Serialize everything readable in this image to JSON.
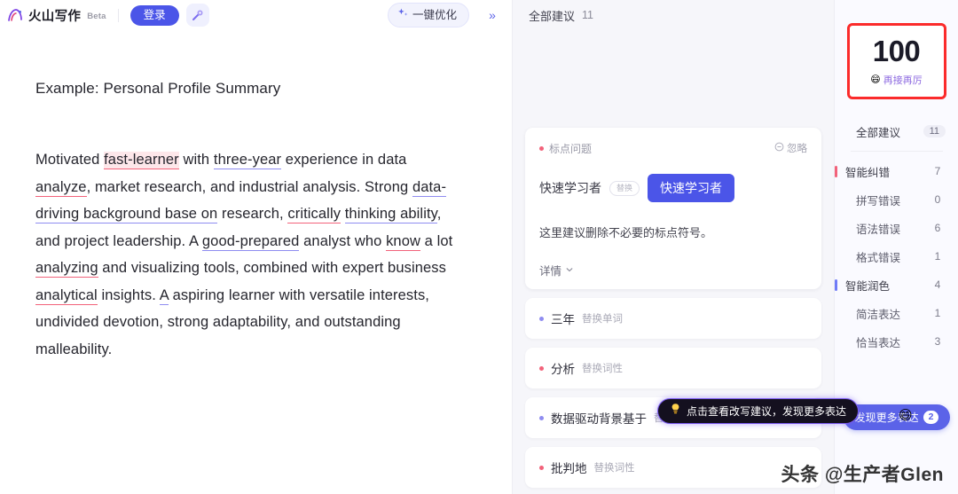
{
  "header": {
    "brand_name": "火山写作",
    "beta_tag": "Beta",
    "login_label": "登录",
    "magic_icon": "magic-wand-icon",
    "optimize_label": "一键优化",
    "optimize_icon": "sparkle-icon",
    "collapse_icon": "double-chevron-right-icon"
  },
  "document": {
    "title": "Example: Personal Profile Summary",
    "paragraph_segments": [
      {
        "text": "Motivated ",
        "style": "plain"
      },
      {
        "text": "fast-learner",
        "style": "highlight-red"
      },
      {
        "text": " with ",
        "style": "plain"
      },
      {
        "text": "three-year",
        "style": "underline-purple"
      },
      {
        "text": " experience in data ",
        "style": "plain"
      },
      {
        "text": "analyze",
        "style": "underline-red"
      },
      {
        "text": ", market research, and industrial analysis. Strong ",
        "style": "plain"
      },
      {
        "text": "data-driving background base on",
        "style": "underline-purple"
      },
      {
        "text": " research, ",
        "style": "plain"
      },
      {
        "text": "critically",
        "style": "underline-red"
      },
      {
        "text": " ",
        "style": "plain"
      },
      {
        "text": "thinking ability",
        "style": "underline-purple"
      },
      {
        "text": ", and project leadership. A ",
        "style": "plain"
      },
      {
        "text": "good-prepared",
        "style": "underline-purple"
      },
      {
        "text": " analyst who ",
        "style": "plain"
      },
      {
        "text": "know",
        "style": "underline-red"
      },
      {
        "text": " a lot ",
        "style": "plain"
      },
      {
        "text": "analyzing",
        "style": "underline-red"
      },
      {
        "text": " and visualizing tools, combined with expert business ",
        "style": "plain"
      },
      {
        "text": "analytical",
        "style": "underline-red"
      },
      {
        "text": " insights. ",
        "style": "plain"
      },
      {
        "text": "A",
        "style": "underline-purple"
      },
      {
        "text": " aspiring learner with versatile interests, undivided devotion, strong adaptability, and outstanding malleability.",
        "style": "plain"
      }
    ]
  },
  "suggestions_panel": {
    "title": "全部建议",
    "count": "11",
    "card": {
      "tag": "标点问题",
      "tag_dot_color": "#f2627a",
      "ignore_label": "忽略",
      "ignore_icon": "circle-minus-icon",
      "original": "快速学习者",
      "arrow": "替换",
      "replacement": "快速学习者",
      "description": "这里建议删除不必要的标点符号。",
      "more_label": "详情",
      "more_icon": "chevron-down-icon"
    },
    "rows": [
      {
        "word": "三年",
        "kind": "替换单词",
        "dot": "purple"
      },
      {
        "word": "分析",
        "kind": "替换词性",
        "dot": "red"
      },
      {
        "word": "数据驱动背景基于",
        "kind": "替换",
        "dot": "purple"
      },
      {
        "word": "批判地",
        "kind": "替换词性",
        "dot": "red"
      }
    ]
  },
  "score": {
    "value": "100",
    "subtitle": "再接再厉",
    "emoji": "😄"
  },
  "categories": [
    {
      "name": "全部建议",
      "count": "11",
      "bar": "none",
      "level": "all",
      "pill": true
    },
    {
      "name": "智能纠错",
      "count": "7",
      "bar": "red",
      "level": "main",
      "pill": false
    },
    {
      "name": "拼写错误",
      "count": "0",
      "bar": "none",
      "level": "sub",
      "pill": false
    },
    {
      "name": "语法错误",
      "count": "6",
      "bar": "none",
      "level": "sub",
      "pill": false
    },
    {
      "name": "格式错误",
      "count": "1",
      "bar": "none",
      "level": "sub",
      "pill": false
    },
    {
      "name": "智能润色",
      "count": "4",
      "bar": "purple",
      "level": "main",
      "pill": false
    },
    {
      "name": "简洁表达",
      "count": "1",
      "bar": "none",
      "level": "sub",
      "pill": false
    },
    {
      "name": "恰当表达",
      "count": "3",
      "bar": "none",
      "level": "sub",
      "pill": false
    }
  ],
  "discover_button": {
    "label": "发现更多表达",
    "badge": "2",
    "emoji": "😄"
  },
  "tooltip": {
    "text": "点击查看改写建议，发现更多表达",
    "icon": "lightbulb-icon"
  },
  "watermark": "头条 @生产者Glen",
  "colors": {
    "accent": "#4b55e8",
    "error": "#f2627a",
    "polish": "#8f8cf0",
    "score_border": "#fb2b2b"
  }
}
